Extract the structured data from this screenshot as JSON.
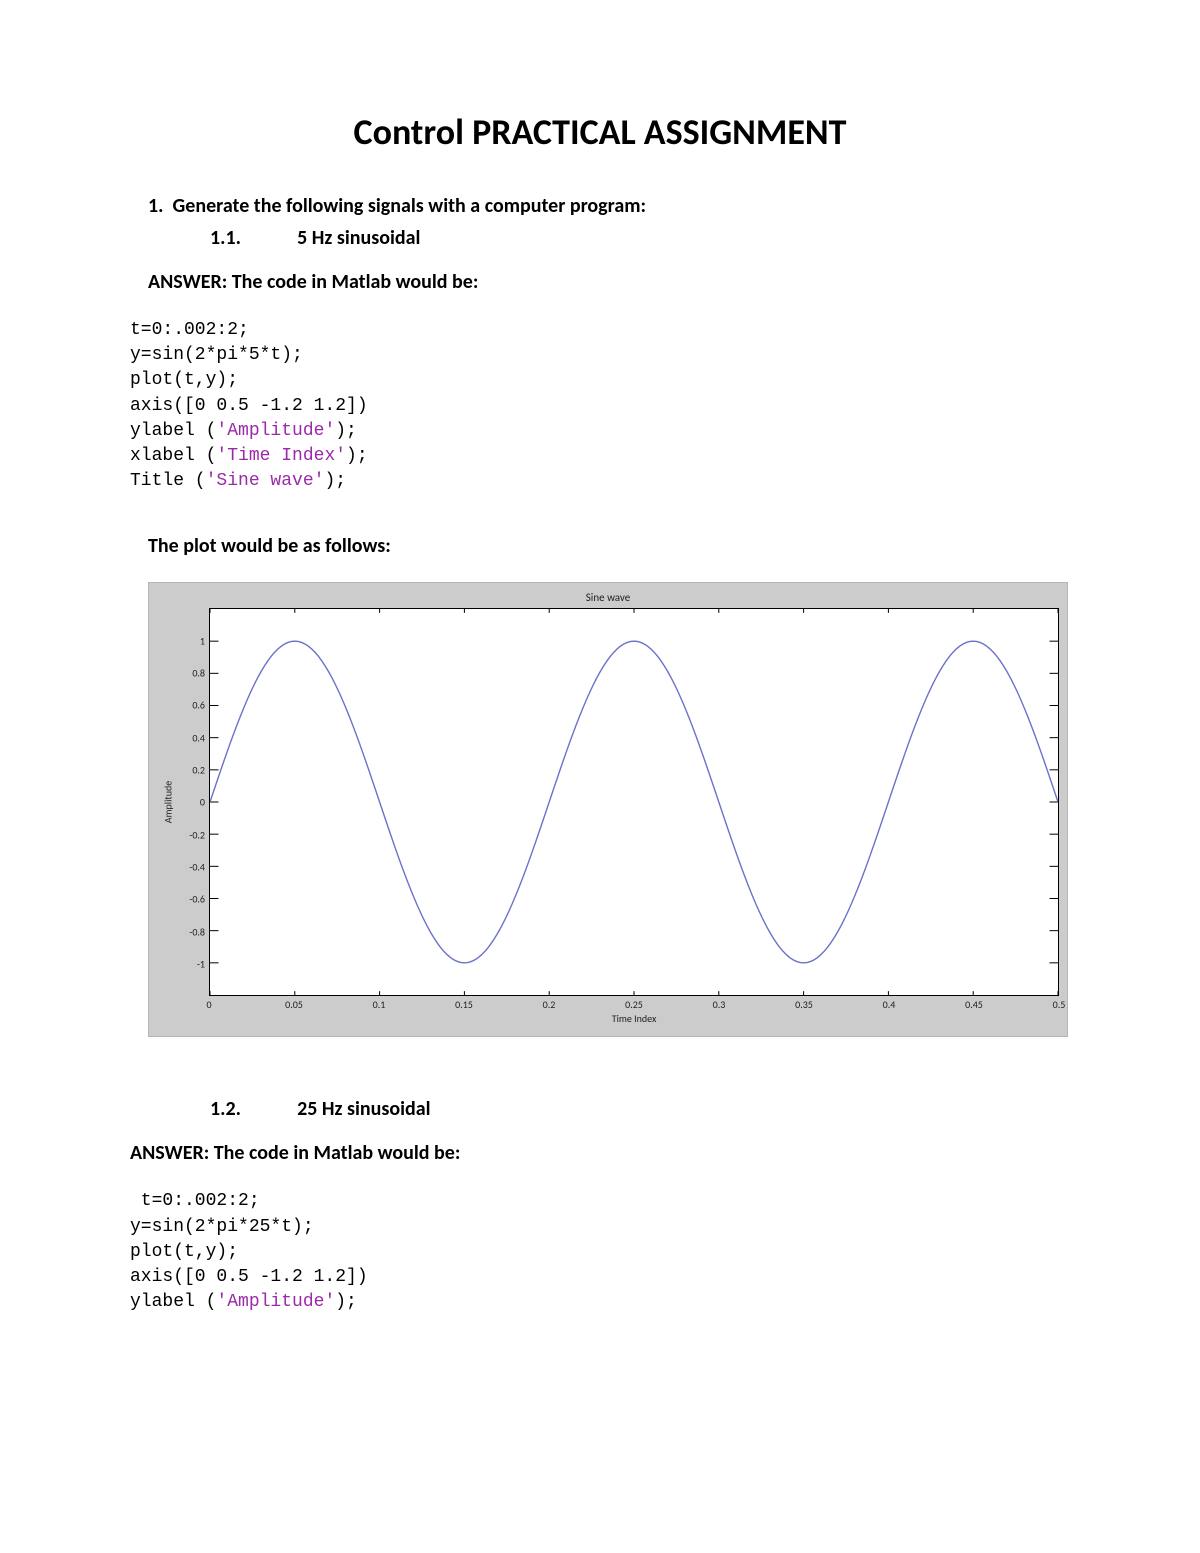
{
  "title": "Control PRACTICAL ASSIGNMENT",
  "q1": {
    "number": "1.",
    "text": "Generate the following signals with a computer program:",
    "sub1": {
      "number": "1.1.",
      "label": "5 Hz sinusoidal"
    },
    "sub2": {
      "number": "1.2.",
      "label": "25 Hz sinusoidal"
    }
  },
  "answer_label": "ANSWER: The code in Matlab would be:",
  "code1": {
    "l1": "t=0:.002:2;",
    "l2": "y=sin(2*pi*5*t);",
    "l3": "plot(t,y);",
    "l4": "axis([0 0.5 -1.2 1.2])",
    "l5a": "ylabel (",
    "l5b": "'Amplitude'",
    "l5c": ");",
    "l6a": "xlabel (",
    "l6b": "'Time Index'",
    "l6c": ");",
    "l7a": "Title (",
    "l7b": "'Sine wave'",
    "l7c": ");"
  },
  "plot_intro": "The plot would be as follows:",
  "code2": {
    "l1": " t=0:.002:2;",
    "l2": "y=sin(2*pi*25*t);",
    "l3": "plot(t,y);",
    "l4": "axis([0 0.5 -1.2 1.2])",
    "l5a": "ylabel (",
    "l5b": "'Amplitude'",
    "l5c": ");"
  },
  "chart_data": {
    "type": "line",
    "title": "Sine wave",
    "xlabel": "Time Index",
    "ylabel": "Amplitude",
    "xlim": [
      0,
      0.5
    ],
    "ylim": [
      -1.2,
      1.2
    ],
    "xticks": [
      0,
      0.05,
      0.1,
      0.15,
      0.2,
      0.25,
      0.3,
      0.35,
      0.4,
      0.45,
      0.5
    ],
    "yticks": [
      -1,
      -0.8,
      -0.6,
      -0.4,
      -0.2,
      0,
      0.2,
      0.4,
      0.6,
      0.8,
      1
    ],
    "series": [
      {
        "name": "sine",
        "frequency_hz": 5,
        "amplitude": 1,
        "dt": 0.002,
        "color": "#6b72c9"
      }
    ]
  }
}
